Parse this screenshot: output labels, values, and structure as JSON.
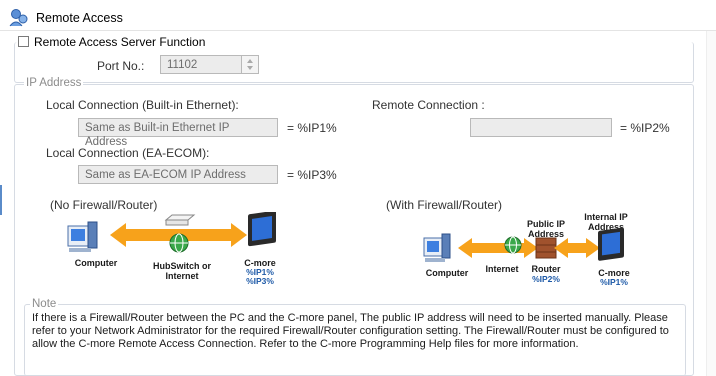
{
  "window": {
    "title": "Remote Access",
    "icon": "network-users-icon"
  },
  "server_function": {
    "label": "Remote Access Server Function",
    "checked": false
  },
  "port": {
    "label": "Port No.:",
    "value": "11102"
  },
  "ip_group": {
    "label": "IP Address",
    "local_builtin": {
      "label": "Local Connection (Built-in Ethernet):",
      "value": "Same as Built-in Ethernet IP Address",
      "tag": "= %IP1%"
    },
    "local_ecom": {
      "label": "Local Connection (EA-ECOM):",
      "value": "Same as EA-ECOM IP Address",
      "tag": "= %IP3%"
    },
    "remote": {
      "label": "Remote Connection :",
      "value": "",
      "tag": "= %IP2%"
    },
    "diagram_left": {
      "caption": "(No Firewall/Router)",
      "computer": "Computer",
      "hub": "HubSwitch or Internet",
      "cmore": "C-more",
      "ip1": "%IP1%",
      "ip3": "%IP3%"
    },
    "diagram_right": {
      "caption": "(With Firewall/Router)",
      "computer": "Computer",
      "internet": "Internet",
      "public_ip": "Public IP Address",
      "internal_ip": "Internal IP Address",
      "router": "Router",
      "ip2": "%IP2%",
      "cmore": "C-more",
      "ip1": "%IP1%"
    }
  },
  "note": {
    "label": "Note",
    "text": "If there is a Firewall/Router between the PC and the C-more panel, The public IP address will need to be inserted manually. Please refer to your Network Administrator for the required Firewall/Router configuration setting. The Firewall/Router must be configured to allow the C-more Remote Access Connection. Refer to the C-more Programming Help files for more information."
  },
  "colors": {
    "arrow": "#f7a21b",
    "link_blue": "#1e5aa8",
    "group_border": "#d6dbe3"
  }
}
